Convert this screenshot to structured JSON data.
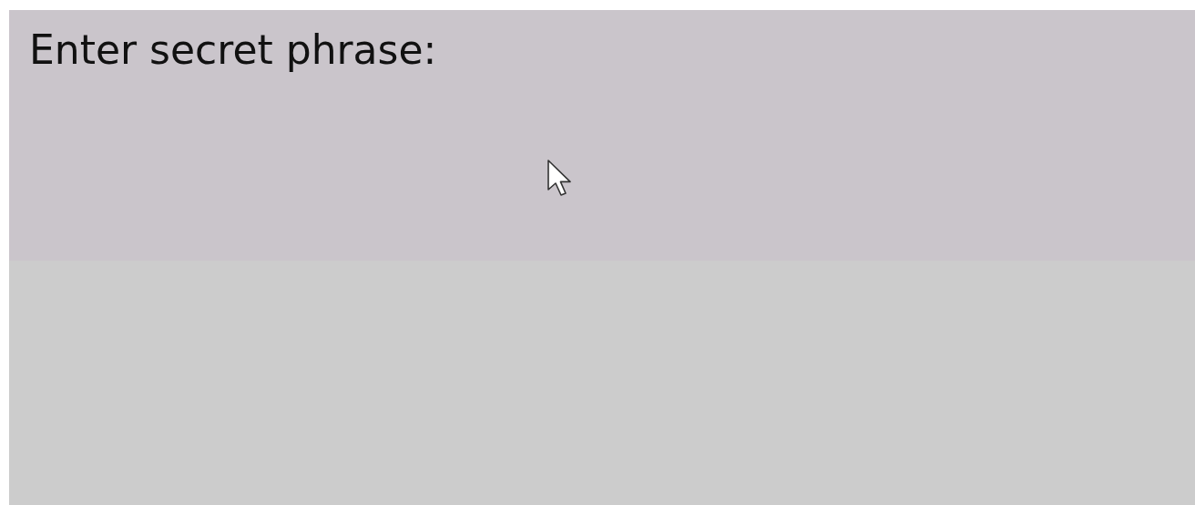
{
  "prompt": {
    "label": "Enter secret phrase:"
  }
}
